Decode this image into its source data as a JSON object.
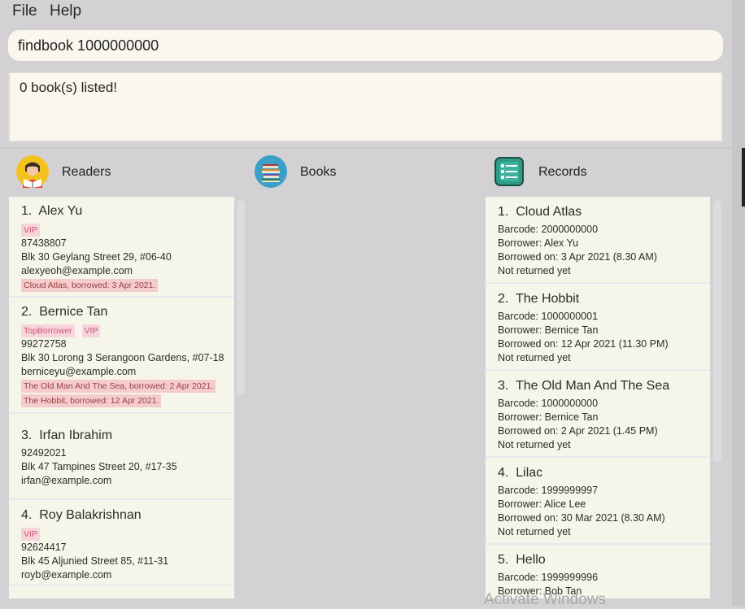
{
  "menu": {
    "file": "File",
    "help": "Help"
  },
  "command": {
    "value": "findbook 1000000000"
  },
  "result": {
    "message": "0 book(s) listed!"
  },
  "sections": {
    "readers": {
      "title": "Readers"
    },
    "books": {
      "title": "Books"
    },
    "records": {
      "title": "Records"
    }
  },
  "readers": [
    {
      "index": "1.",
      "name": "Alex Yu",
      "tags": [
        "VIP"
      ],
      "phone": "87438807",
      "address": "Blk 30 Geylang Street 29, #06-40",
      "email": "alexyeoh@example.com",
      "borrowed": [
        "Cloud Atlas, borrowed: 3 Apr 2021."
      ]
    },
    {
      "index": "2.",
      "name": "Bernice Tan",
      "tags": [
        "TopBorrower",
        "VIP"
      ],
      "phone": "99272758",
      "address": "Blk 30 Lorong 3 Serangoon Gardens, #07-18",
      "email": "berniceyu@example.com",
      "borrowed": [
        "The Old Man And The Sea, borrowed: 2 Apr 2021.",
        "The Hobbit, borrowed: 12 Apr 2021."
      ]
    },
    {
      "index": "3.",
      "name": "Irfan Ibrahim",
      "tags": [],
      "phone": "92492021",
      "address": "Blk 47 Tampines Street 20, #17-35",
      "email": "irfan@example.com",
      "borrowed": []
    },
    {
      "index": "4.",
      "name": "Roy Balakrishnan",
      "tags": [
        "VIP"
      ],
      "phone": "92624417",
      "address": "Blk 45 Aljunied Street 85, #11-31",
      "email": "royb@example.com",
      "borrowed": []
    }
  ],
  "records": [
    {
      "index": "1.",
      "title": "Cloud Atlas",
      "barcode": "Barcode: 2000000000",
      "borrower": "Borrower: Alex Yu",
      "borrowed_on": "Borrowed on: 3 Apr 2021 (8.30 AM)",
      "status": "Not returned yet"
    },
    {
      "index": "2.",
      "title": "The Hobbit",
      "barcode": "Barcode: 1000000001",
      "borrower": "Borrower: Bernice Tan",
      "borrowed_on": "Borrowed on: 12 Apr 2021 (11.30 PM)",
      "status": "Not returned yet"
    },
    {
      "index": "3.",
      "title": "The Old Man And The Sea",
      "barcode": "Barcode: 1000000000",
      "borrower": "Borrower: Bernice Tan",
      "borrowed_on": "Borrowed on: 2 Apr 2021 (1.45 PM)",
      "status": "Not returned yet"
    },
    {
      "index": "4.",
      "title": "Lilac",
      "barcode": "Barcode: 1999999997",
      "borrower": "Borrower: Alice Lee",
      "borrowed_on": "Borrowed on: 30 Mar 2021 (8.30 AM)",
      "status": "Not returned yet"
    },
    {
      "index": "5.",
      "title": "Hello",
      "barcode": "Barcode: 1999999996",
      "borrower": "Borrower: Bob Tan",
      "borrowed_on": "",
      "status": ""
    }
  ],
  "watermark": "Activate Windows",
  "colors": {
    "background": "#d3d1d4",
    "panel": "#f6f5e9",
    "input": "#faf8ee",
    "tag": "#f7d3de",
    "borrowed_tag": "#f5cccc"
  }
}
